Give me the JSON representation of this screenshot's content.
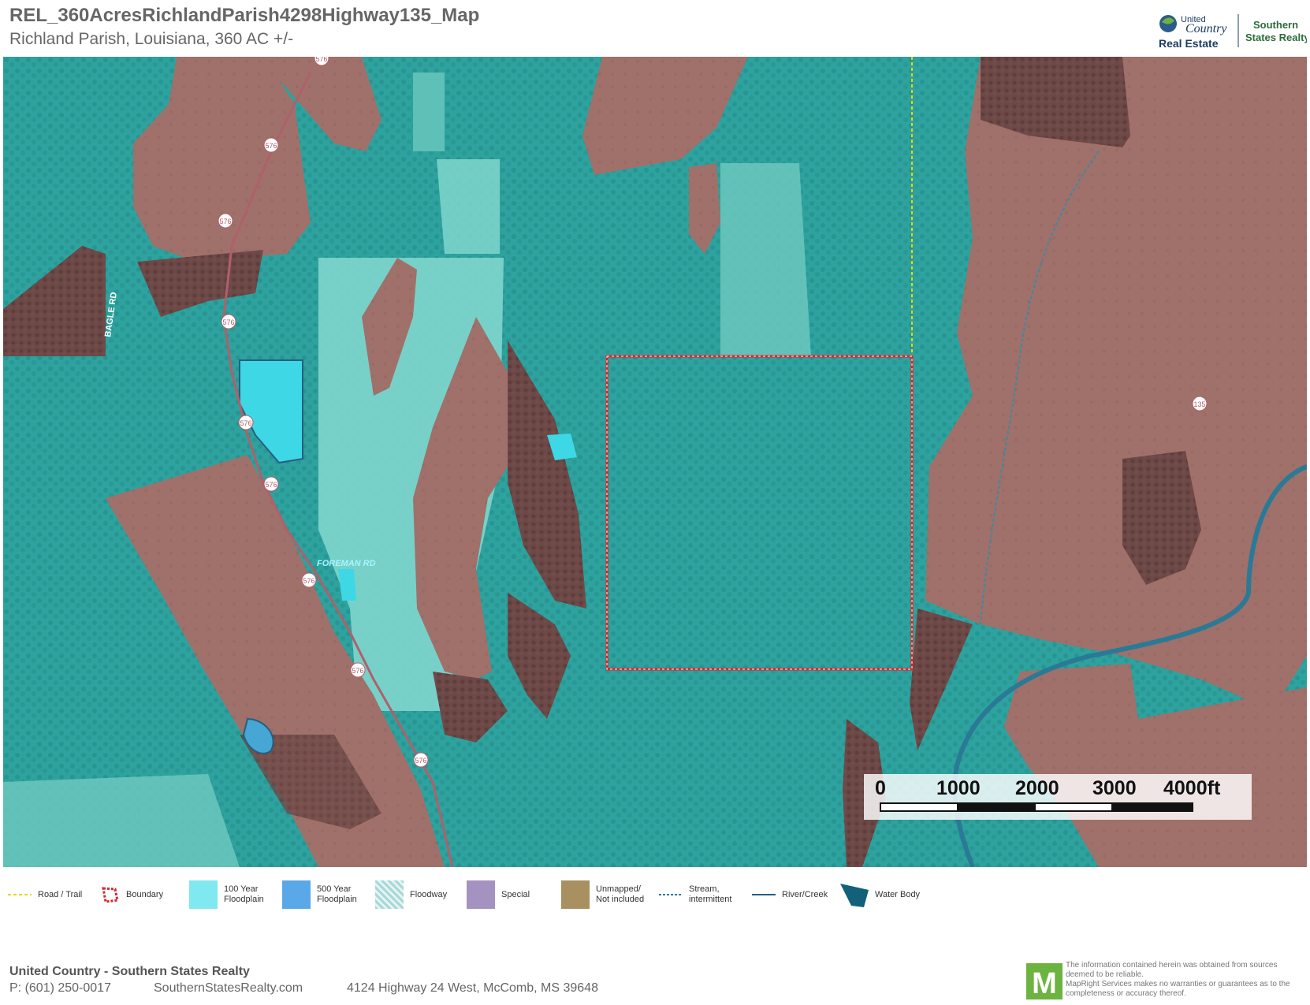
{
  "header": {
    "title": "REL_360AcresRichlandParish4298Highway135_Map",
    "subtitle": "Richland Parish, Louisiana, 360 AC +/-"
  },
  "logo": {
    "united": "United",
    "country": "Country",
    "real_estate": "Real Estate",
    "brand_line1": "Southern",
    "brand_line2": "States Realty"
  },
  "map": {
    "road_labels": [
      "576",
      "576",
      "576",
      "576",
      "576",
      "576",
      "576",
      "576",
      "576",
      "135"
    ],
    "street_labels": [
      "BAGLE RD",
      "FOREMAN RD"
    ],
    "colors": {
      "floodzone_teal": "#3aaeab",
      "upland_brown": "#a0706a",
      "dark_woods": "#6a4a48",
      "light_teal": "#7fd6cc",
      "boundary": "#d7262c"
    }
  },
  "scalebar": {
    "ticks": [
      "0",
      "1000",
      "2000",
      "3000",
      "4000ft"
    ]
  },
  "legend": {
    "items": [
      {
        "label": "Road / Trail",
        "icon": "road-trail-icon",
        "color": "#e6d800"
      },
      {
        "label": "Boundary",
        "icon": "boundary-icon",
        "color": "#d7262c"
      },
      {
        "label": "100 Year\nFloodplain",
        "icon": "100-year-floodplain-icon",
        "color": "#7fe8f0"
      },
      {
        "label": "500 Year\nFloodplain",
        "icon": "500-year-floodplain-icon",
        "color": "#5ba8e8"
      },
      {
        "label": "Floodway",
        "icon": "floodway-icon",
        "color": "#a8d8d8"
      },
      {
        "label": "Special",
        "icon": "special-icon",
        "color": "#a592c0"
      },
      {
        "label": "Unmapped/\nNot included",
        "icon": "unmapped-icon",
        "color": "#a89060"
      },
      {
        "label": "Stream,\nintermittent",
        "icon": "stream-intermittent-icon",
        "color": "#2a7aa0"
      },
      {
        "label": "River/Creek",
        "icon": "river-creek-icon",
        "color": "#1f5e85"
      },
      {
        "label": "Water Body",
        "icon": "water-body-icon",
        "color": "#12607a"
      }
    ]
  },
  "footer": {
    "company": "United Country - Southern States Realty",
    "phone": "P: (601) 250-0017",
    "website": "SouthernStatesRealty.com",
    "address": "4124 Highway 24 West, McComb, MS 39648",
    "mapright_letter": "M",
    "disclaimer": "The information contained herein was obtained from sources\ndeemed to be reliable.\nMapRight Services makes no warranties or guarantees as to the\ncompleteness or accuracy thereof."
  }
}
